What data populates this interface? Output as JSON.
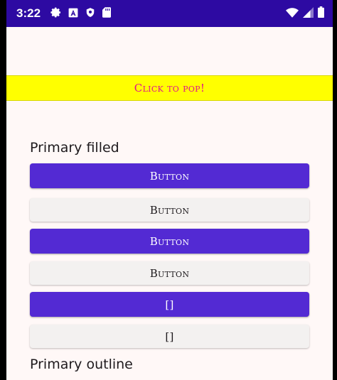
{
  "status_bar": {
    "time": "3:22",
    "left_icons": [
      "gear-icon",
      "a-letter-icon",
      "shield-icon",
      "sd-card-icon"
    ],
    "right_icons": [
      "wifi-icon",
      "signal-icon",
      "battery-icon"
    ],
    "color": "#2d0aa2"
  },
  "banner": {
    "label": "Click to pop!",
    "bg_color": "#ffff00",
    "text_color": "#e0148c"
  },
  "sections": {
    "primary_filled": "Primary filled",
    "primary_outline": "Primary outline"
  },
  "buttons": [
    {
      "label": "Button",
      "variant": "filled"
    },
    {
      "label": "Button",
      "variant": "light"
    },
    {
      "label": "Button",
      "variant": "filled"
    },
    {
      "label": "Button",
      "variant": "light"
    },
    {
      "label": "[]",
      "variant": "filled"
    },
    {
      "label": "[]",
      "variant": "light"
    }
  ],
  "colors": {
    "accent": "#532ad3",
    "surface": "#fff8f7",
    "light_button": "#f3f1f0"
  }
}
